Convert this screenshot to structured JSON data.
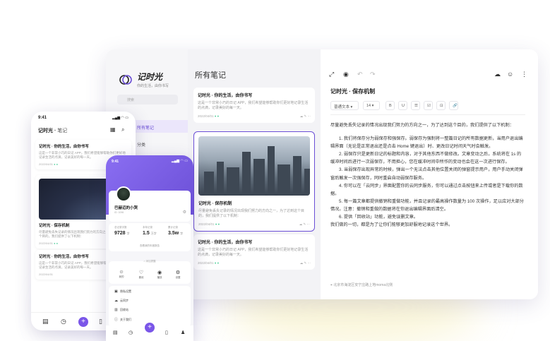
{
  "colors": {
    "accent": "#6b4fd6",
    "accent_light": "#ebe6fb",
    "green_dots": "#5bd1a0"
  },
  "desktop": {
    "brand": {
      "name": "记时光",
      "slogan": "你的生活，由你书写"
    },
    "search_placeholder": "搜索",
    "nav": [
      {
        "label": "所有笔记",
        "active": true
      },
      {
        "label": "分类",
        "active": false
      }
    ],
    "list_title": "所有笔记",
    "notes": [
      {
        "title": "记时光 · 你的生活，由你书写",
        "preview": "这是一个非常小巧的日记 APP，我们希望能够帮助你们更好地记录生活的点滴，记录美好的每一天。",
        "date": "2022/04/01"
      },
      {
        "title": "记时光 · 保存机制",
        "preview": "尽量避免丢失记录的情况出现我们努力的方向之一，为了达到这个目的，我们提供了以下机制：",
        "date": "2022/04/01"
      },
      {
        "title": "记时光 · 你的生活，由你书写",
        "preview": "这是一个非常小巧的日记 APP，我们希望能够帮助你们更好地记录生活的点滴，记录美好的每一天。",
        "date": "2022/04/01"
      }
    ],
    "toolbar": {
      "expand_icon": "expand-icon",
      "preview_icon": "eye-icon",
      "undo_icon": "undo-icon",
      "redo_icon": "redo-icon",
      "cloud_icon": "cloud-icon",
      "emoji_icon": "smile-icon",
      "more_icon": "more-vertical-icon"
    },
    "editor": {
      "title": "记时光 · 保存机制",
      "format_style": "普通文本",
      "font_size": "14",
      "format_buttons": [
        "B",
        "U",
        "☰",
        "☑",
        "⊡",
        "🔗"
      ],
      "intro": "尽量避免丢失记录的情况出现我们努力的方向之一，为了达到这个目的，我们提供了以下机制：",
      "items": [
        "1. 我们将保存分为弱保存和强保存。弱保存为强制将一整篇日记的所有数据更新，当用户退出编辑界面（无论是正常退出还是点击 Home 键退出）时、更改日记时间天气时会触发。",
        "2. 弱保存只是更新日记的标题和内容，对于其他东西不做修改。文章变动之后，系统将在 1s 的缓冲时间后进行一次弱保存，不用担心，您在缓冲时间中所作的变动也会在这一次进行保存。",
        "3. 当弱保存出现异常的时候，弹出一个无法点击其他位置关闭的弹窗提示用户，用户手动关闭弹窗后触发一次强保存，同时重启自动弱保存服务。",
        "4. 你可以在「云同步」界面配置你的云同步服务，你可以通过点击按钮来上传或者是下载你的数据。",
        "5. 每一篇文章都提供撤销和重做功能，并且记录的最高操作数量为 100 次操作，足以应对大部分情况。注意：撤销和重做的数据将在你退出编辑界面后清空。",
        "6. 提供「回收站」功能，避免误删文章。"
      ],
      "outro": "我们做的一切，都是为了让你们能够更加舒服地记录这个世界。",
      "footer": "北京市海淀区安宁庄路上地moma北侧"
    }
  },
  "phone1": {
    "time": "9:41",
    "app_name": "记时光",
    "section": "笔记",
    "cards": [
      {
        "title": "记时光 · 你的生活，由你书写",
        "preview": "这是一个非常小巧的日记 APP，我们希望能够帮助你们更好地记录生活的点滴，记录美好的每一天。",
        "date": "2022/04/01"
      },
      {
        "title": "记时光 · 保存机制",
        "preview": "尽量避免丢失记录的情况出现我们努力的方向之一，为了达到这个目的，我们提供了以下机制：",
        "date": "2022/04/01"
      },
      {
        "title": "记时光 · 你的生活，由你书写",
        "preview": "这是一个非常小巧的日记 APP，我们希望能够帮助你们更好地记录生活的点滴，记录美好的每一天。",
        "date": "2022/04/01"
      }
    ]
  },
  "phone2": {
    "time": "9:41",
    "username": "巴赫迈的小哭",
    "user_id": "ID: 1096",
    "stats": [
      {
        "label": "总记录字数",
        "value": "9728",
        "unit": "字"
      },
      {
        "label": "本年记录",
        "value": "1.5",
        "unit": "万字"
      },
      {
        "label": "累计记录",
        "value": "3.5w",
        "unit": "字"
      }
    ],
    "report_link": "查看我的年度报告",
    "bar_text": "添加提醒",
    "quick": [
      {
        "icon": "smile-icon",
        "label": "我的"
      },
      {
        "icon": "heart-icon",
        "label": "喜欢"
      },
      {
        "icon": "play-icon",
        "label": "播放"
      },
      {
        "icon": "gear-icon",
        "label": "设置"
      }
    ],
    "menu": [
      {
        "icon": "lock-icon",
        "label": "隐私设置"
      },
      {
        "icon": "cloud-icon",
        "label": "云同步"
      },
      {
        "icon": "trash-icon",
        "label": "回收站"
      },
      {
        "icon": "info-icon",
        "label": "关于我们"
      }
    ]
  }
}
